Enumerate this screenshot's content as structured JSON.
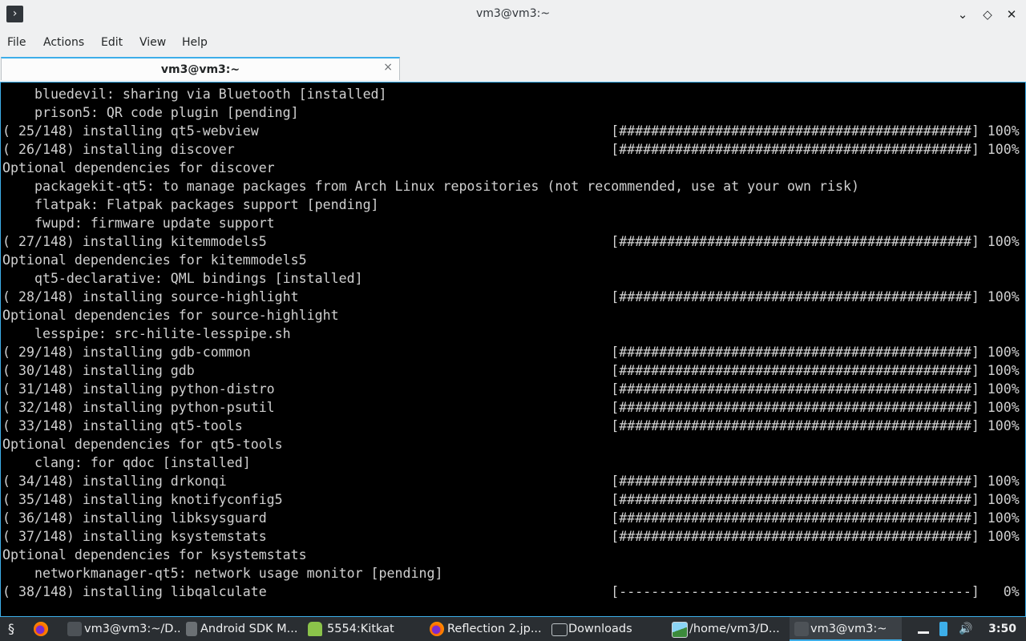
{
  "window": {
    "title": "vm3@vm3:~",
    "app_icon_glyph": "›",
    "minimize_glyph": "⌄",
    "maximize_glyph": "◇",
    "close_glyph": "✕"
  },
  "menu": {
    "file": "File",
    "actions": "Actions",
    "edit": "Edit",
    "view": "View",
    "help": "Help"
  },
  "tab": {
    "title": "vm3@vm3:~",
    "close_glyph": "×"
  },
  "terminal": {
    "lines": [
      "    bluedevil: sharing via Bluetooth [installed]",
      "    prison5: QR code plugin [pending]",
      "( 25/148) installing qt5-webview                                            [############################################] 100%",
      "( 26/148) installing discover                                               [############################################] 100%",
      "Optional dependencies for discover",
      "    packagekit-qt5: to manage packages from Arch Linux repositories (not recommended, use at your own risk)",
      "    flatpak: Flatpak packages support [pending]",
      "    fwupd: firmware update support",
      "( 27/148) installing kitemmodels5                                           [############################################] 100%",
      "Optional dependencies for kitemmodels5",
      "    qt5-declarative: QML bindings [installed]",
      "( 28/148) installing source-highlight                                       [############################################] 100%",
      "Optional dependencies for source-highlight",
      "    lesspipe: src-hilite-lesspipe.sh",
      "( 29/148) installing gdb-common                                             [############################################] 100%",
      "( 30/148) installing gdb                                                    [############################################] 100%",
      "( 31/148) installing python-distro                                          [############################################] 100%",
      "( 32/148) installing python-psutil                                          [############################################] 100%",
      "( 33/148) installing qt5-tools                                              [############################################] 100%",
      "Optional dependencies for qt5-tools",
      "    clang: for qdoc [installed]",
      "( 34/148) installing drkonqi                                                [############################################] 100%",
      "( 35/148) installing knotifyconfig5                                         [############################################] 100%",
      "( 36/148) installing libksysguard                                           [############################################] 100%",
      "( 37/148) installing ksystemstats                                           [############################################] 100%",
      "Optional dependencies for ksystemstats",
      "    networkmanager-qt5: network usage monitor [pending]",
      "( 38/148) installing libqalculate                                           [--------------------------------------------]   0%"
    ]
  },
  "taskbar": {
    "launcher_icon": "launcher-icon",
    "firefox_icon": "firefox-icon",
    "items": [
      {
        "label": "vm3@vm3:~/D...",
        "icon": "terminal-icon"
      },
      {
        "label": "Android SDK M...",
        "icon": "download-icon"
      },
      {
        "label": "5554:Kitkat",
        "icon": "android-icon"
      },
      {
        "label": "Reflection 2.jp...",
        "icon": "firefox-icon"
      },
      {
        "label": "Downloads",
        "icon": "folder-icon"
      },
      {
        "label": "/home/vm3/D...",
        "icon": "image-viewer-icon"
      },
      {
        "label": "vm3@vm3:~",
        "icon": "terminal-icon"
      }
    ],
    "clock": "3:50",
    "colors": {
      "accent": "#3daee9",
      "panel": "#2a2e32"
    }
  }
}
